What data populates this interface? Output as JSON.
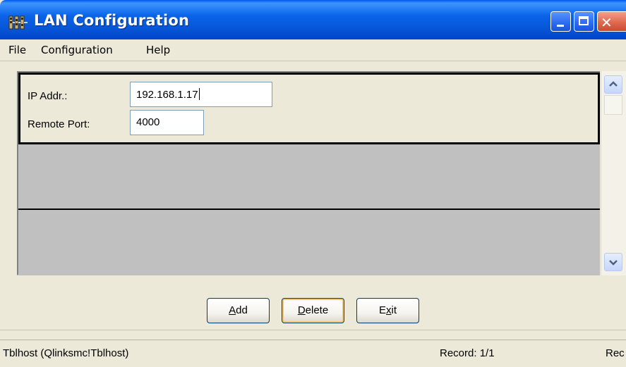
{
  "window": {
    "title": "LAN Configuration",
    "icon": "network-app-icon",
    "controls": {
      "minimize": "minimize-icon",
      "maximize": "maximize-icon",
      "close": "close-icon"
    }
  },
  "menu": {
    "items": [
      {
        "label": "File"
      },
      {
        "label": "Configuration"
      },
      {
        "label": "Help"
      }
    ]
  },
  "form": {
    "ip_label": "IP Addr.:",
    "ip_value": "192.168.1.17",
    "port_label": "Remote Port:",
    "port_value": "4000"
  },
  "buttons": {
    "add": {
      "mnemonic": "A",
      "rest": "dd"
    },
    "delete": {
      "mnemonic": "D",
      "rest": "elete"
    },
    "exit": {
      "pre": "E",
      "mnemonic": "x",
      "rest": "it"
    }
  },
  "status": {
    "table": "Tblhost (Qlinksmc!Tblhost)",
    "record": "Record: 1/1",
    "truncated": "Rec"
  },
  "colors": {
    "titlebar": "#0a63e8",
    "face": "#ece9d8",
    "empty_record": "#c0c0c0",
    "focus_ring": "#f4c56a"
  }
}
